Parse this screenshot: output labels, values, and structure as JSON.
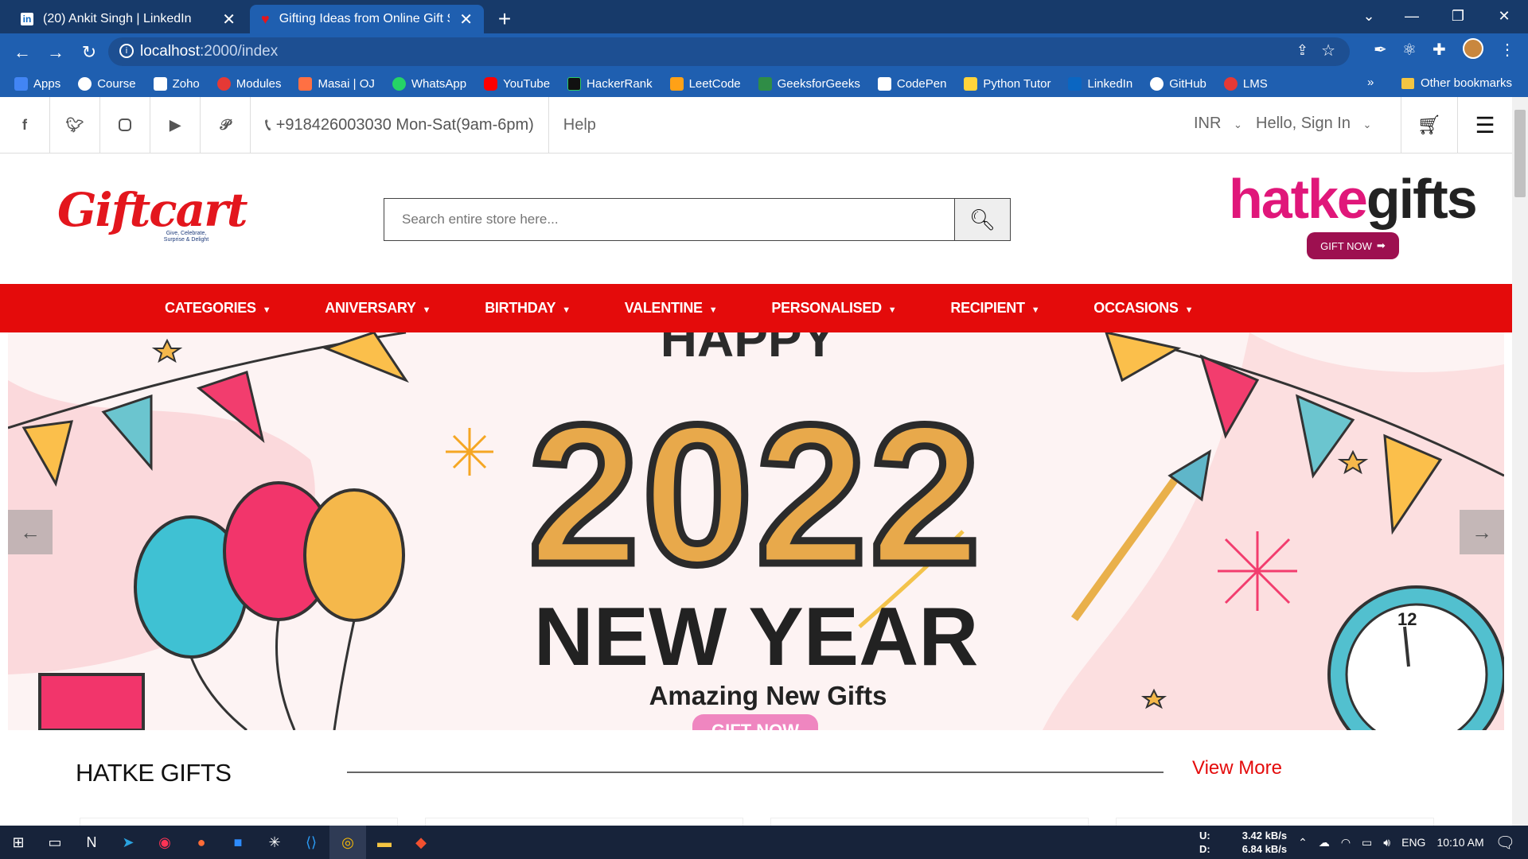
{
  "browser": {
    "tabs": [
      {
        "title": "(20) Ankit Singh | LinkedIn",
        "favicon": "linkedin-icon",
        "active": false
      },
      {
        "title": "Gifting Ideas from Online Gift Sto",
        "favicon": "giftcart-heart-icon",
        "active": true
      }
    ],
    "url_host": "localhost",
    "url_rest": ":2000/index",
    "bookmarks": [
      {
        "label": "Apps",
        "color": "#4285f4"
      },
      {
        "label": "Course",
        "color": "#ffffff"
      },
      {
        "label": "Zoho",
        "color": "#ffffff"
      },
      {
        "label": "Modules",
        "color": "#e53935"
      },
      {
        "label": "Masai | OJ",
        "color": "#ff7043"
      },
      {
        "label": "WhatsApp",
        "color": "#25d366"
      },
      {
        "label": "YouTube",
        "color": "#ff0000"
      },
      {
        "label": "HackerRank",
        "color": "#111111"
      },
      {
        "label": "LeetCode",
        "color": "#ffa116"
      },
      {
        "label": "GeeksforGeeks",
        "color": "#2f8d46"
      },
      {
        "label": "CodePen",
        "color": "#ffffff"
      },
      {
        "label": "Python Tutor",
        "color": "#ffd43b"
      },
      {
        "label": "LinkedIn",
        "color": "#0a66c2"
      },
      {
        "label": "GitHub",
        "color": "#ffffff"
      },
      {
        "label": "LMS",
        "color": "#e53935"
      }
    ],
    "overflow": "»",
    "other_bookmarks": "Other bookmarks"
  },
  "site": {
    "phone": "+918426003030 Mon-Sat(9am-6pm)",
    "help": "Help",
    "currency": "INR",
    "signin": "Hello, Sign In",
    "logo_brand": "Giftcart",
    "logo_tagline": "Give, Celebrate, Surprise & Delight",
    "search_placeholder": "Search entire store here...",
    "hatke_logo": {
      "part1": "hatke",
      "part2": "gifts"
    },
    "gift_now": "GIFT NOW",
    "categories": [
      "CATEGORIES",
      "ANIVERSARY",
      "BIRTHDAY",
      "VALENTINE",
      "PERSONALISED",
      "RECIPIENT",
      "OCCASIONS"
    ],
    "banner": {
      "happy": "HAPPY",
      "year": "2022",
      "headline": "NEW YEAR",
      "sub": "Amazing New Gifts",
      "button": "GIFT NOW",
      "clock_number": "12"
    },
    "section_title": "HATKE GIFTS",
    "view_more": "View More"
  },
  "taskbar": {
    "upload_label": "U:",
    "upload_speed": "3.42 kB/s",
    "download_label": "D:",
    "download_speed": "6.84 kB/s",
    "language": "ENG",
    "time": "10:10 AM"
  },
  "colors": {
    "accent_red": "#e40b0b",
    "browser_blue": "#1f5fb0",
    "title_navy": "#173a6a"
  }
}
